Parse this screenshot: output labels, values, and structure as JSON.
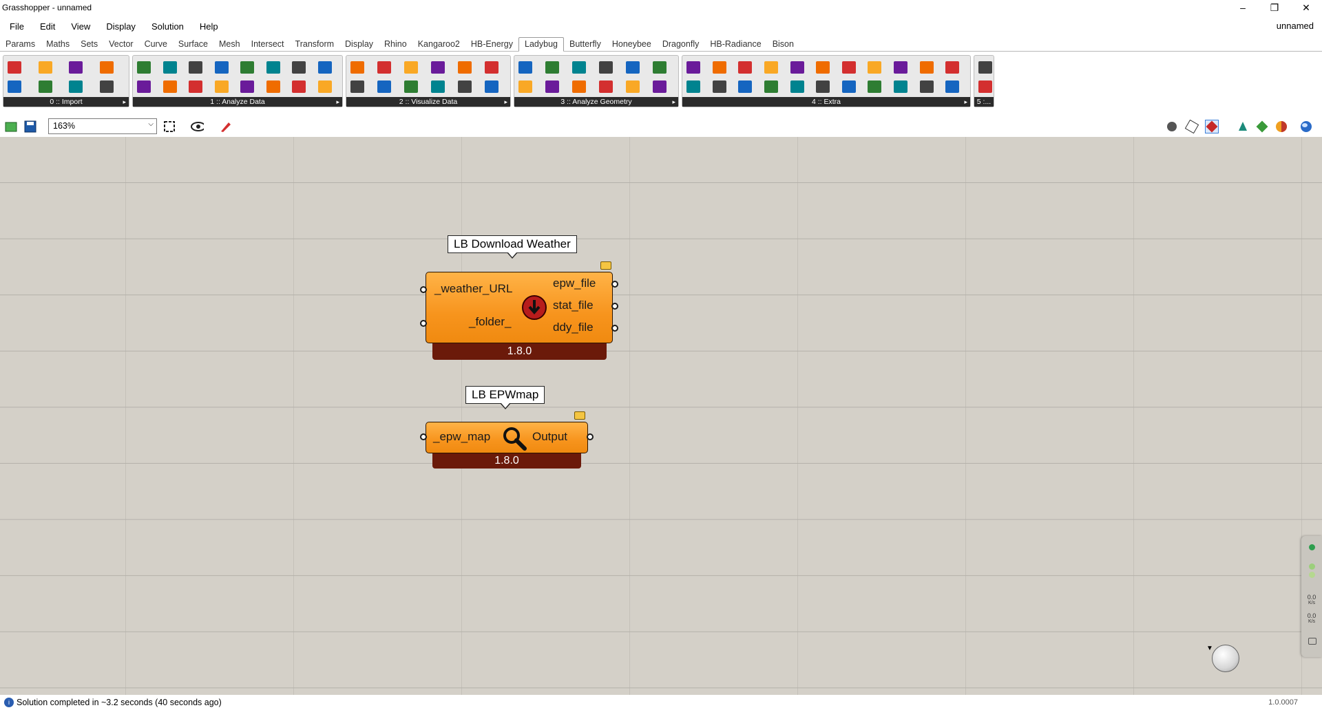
{
  "window": {
    "title": "Grasshopper - unnamed",
    "minimize": "–",
    "restore": "❐",
    "close": "✕"
  },
  "menu": [
    "File",
    "Edit",
    "View",
    "Display",
    "Solution",
    "Help"
  ],
  "document_name": "unnamed",
  "tabs": [
    "Params",
    "Maths",
    "Sets",
    "Vector",
    "Curve",
    "Surface",
    "Mesh",
    "Intersect",
    "Transform",
    "Display",
    "Rhino",
    "Kangaroo2",
    "HB-Energy",
    "Ladybug",
    "Butterfly",
    "Honeybee",
    "Dragonfly",
    "HB-Radiance",
    "Bison"
  ],
  "active_tab": "Ladybug",
  "ribbon_groups": [
    {
      "label": "0 :: Import",
      "icon_count": 8
    },
    {
      "label": "1 :: Analyze Data",
      "icon_count": 16
    },
    {
      "label": "2 :: Visualize Data",
      "icon_count": 12
    },
    {
      "label": "3 :: Analyze Geometry",
      "icon_count": 12
    },
    {
      "label": "4 :: Extra",
      "icon_count": 22
    },
    {
      "label": "5 :...",
      "icon_count": 2
    }
  ],
  "canvas_toolbar": {
    "zoom": "163%"
  },
  "components": [
    {
      "name": "LB Download Weather",
      "inputs": [
        "_weather_URL",
        "_folder_"
      ],
      "outputs": [
        "epw_file",
        "stat_file",
        "ddy_file"
      ],
      "version": "1.8.0",
      "icon": "ladybug-download-icon"
    },
    {
      "name": "LB EPWmap",
      "inputs": [
        "_epw_map"
      ],
      "outputs": [
        "Output"
      ],
      "version": "1.8.0",
      "icon": "magnifier-icon"
    }
  ],
  "side_widget": {
    "rate1": "0.0",
    "unit1": "K/s",
    "rate2": "0.0",
    "unit2": "K/s"
  },
  "status": {
    "message": "Solution completed in ~3.2 seconds (40 seconds ago)",
    "version": "1.0.0007"
  }
}
